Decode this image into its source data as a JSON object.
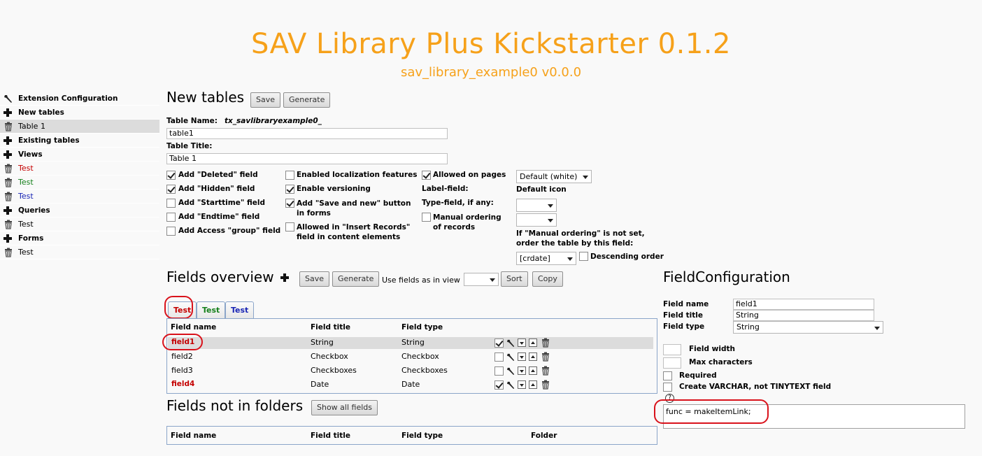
{
  "header": {
    "title": "SAV Library Plus Kickstarter 0.1.2",
    "subtitle": "sav_library_example0 v0.0.0"
  },
  "sidebar": {
    "items": [
      {
        "label": "Extension Configuration",
        "icon": "wrench-icon"
      },
      {
        "label": "New tables",
        "icon": "plus-icon"
      },
      {
        "label": "Table 1",
        "icon": "trash-icon"
      },
      {
        "label": "Existing tables",
        "icon": "plus-icon"
      },
      {
        "label": "Views",
        "icon": "plus-icon"
      },
      {
        "label": "Test",
        "icon": "trash-icon",
        "color": "#c40000"
      },
      {
        "label": "Test",
        "icon": "trash-icon",
        "color": "#16801c"
      },
      {
        "label": "Test",
        "icon": "trash-icon",
        "color": "#1a26b5"
      },
      {
        "label": "Queries",
        "icon": "plus-icon"
      },
      {
        "label": "Test",
        "icon": "trash-icon"
      },
      {
        "label": "Forms",
        "icon": "plus-icon"
      },
      {
        "label": "Test",
        "icon": "trash-icon"
      }
    ]
  },
  "new_tables": {
    "title": "New tables",
    "save_label": "Save",
    "generate_label": "Generate",
    "table_name_label": "Table Name:",
    "table_name_prefix": "tx_savlibraryexample0_",
    "table_name_value": "table1",
    "table_title_label": "Table Title:",
    "table_title_value": "Table 1",
    "options_col1": [
      {
        "label": "Add \"Deleted\" field",
        "checked": true
      },
      {
        "label": "Add \"Hidden\" field",
        "checked": true
      },
      {
        "label": "Add \"Starttime\" field",
        "checked": false
      },
      {
        "label": "Add \"Endtime\" field",
        "checked": false
      },
      {
        "label": "Add Access \"group\" field",
        "checked": false
      }
    ],
    "options_col2": [
      {
        "label": "Enabled localization features",
        "checked": false
      },
      {
        "label": "Enable versioning",
        "checked": true
      },
      {
        "label": "Add \"Save and new\" button in forms",
        "checked": true
      },
      {
        "label": "Allowed in \"Insert Records\" field in content elements",
        "checked": false
      }
    ],
    "allowed_on_pages": {
      "label": "Allowed on pages",
      "checked": true
    },
    "label_field_label": "Label-field:",
    "type_field_label": "Type-field, if any:",
    "manual_ordering": {
      "label": "Manual ordering of records",
      "checked": false
    },
    "default_select_value": "Default (white)",
    "default_icon_label": "Default icon",
    "ordering_note": "If \"Manual ordering\" is not set, order the table by this field:",
    "order_select_value": "[crdate]",
    "descending": {
      "label": "Descending order",
      "checked": false
    }
  },
  "fields_overview": {
    "title": "Fields overview",
    "save_label": "Save",
    "generate_label": "Generate",
    "use_fields_label": "Use fields as in view",
    "sort_label": "Sort",
    "copy_label": "Copy",
    "tabs": [
      {
        "label": "Test",
        "color": "#c40000"
      },
      {
        "label": "Test",
        "color": "#16801c"
      },
      {
        "label": "Test",
        "color": "#1a26b5"
      }
    ],
    "columns": [
      "Field name",
      "Field title",
      "Field type"
    ],
    "rows": [
      {
        "name": "field1",
        "title": "String",
        "type": "String",
        "checked": true,
        "highlight": true
      },
      {
        "name": "field2",
        "title": "Checkbox",
        "type": "Checkbox",
        "checked": false,
        "highlight": false
      },
      {
        "name": "field3",
        "title": "Checkboxes",
        "type": "Checkboxes",
        "checked": false,
        "highlight": false
      },
      {
        "name": "field4",
        "title": "Date",
        "type": "Date",
        "checked": true,
        "highlight": false
      }
    ]
  },
  "fields_not_in_folders": {
    "title": "Fields not in folders",
    "show_all_label": "Show all fields",
    "columns": [
      "Field name",
      "Field title",
      "Field type",
      "Folder"
    ]
  },
  "field_configuration": {
    "title": "FieldConfiguration",
    "field_name_label": "Field name",
    "field_name_value": "field1",
    "field_title_label": "Field title",
    "field_title_value": "String",
    "field_type_label": "Field type",
    "field_type_value": "String",
    "field_width_label": "Field width",
    "max_characters_label": "Max characters",
    "required_label": "Required",
    "varchar_label": "Create VARCHAR, not TINYTEXT field",
    "help_symbol": "?",
    "code_value": "func = makeItemLink;"
  }
}
